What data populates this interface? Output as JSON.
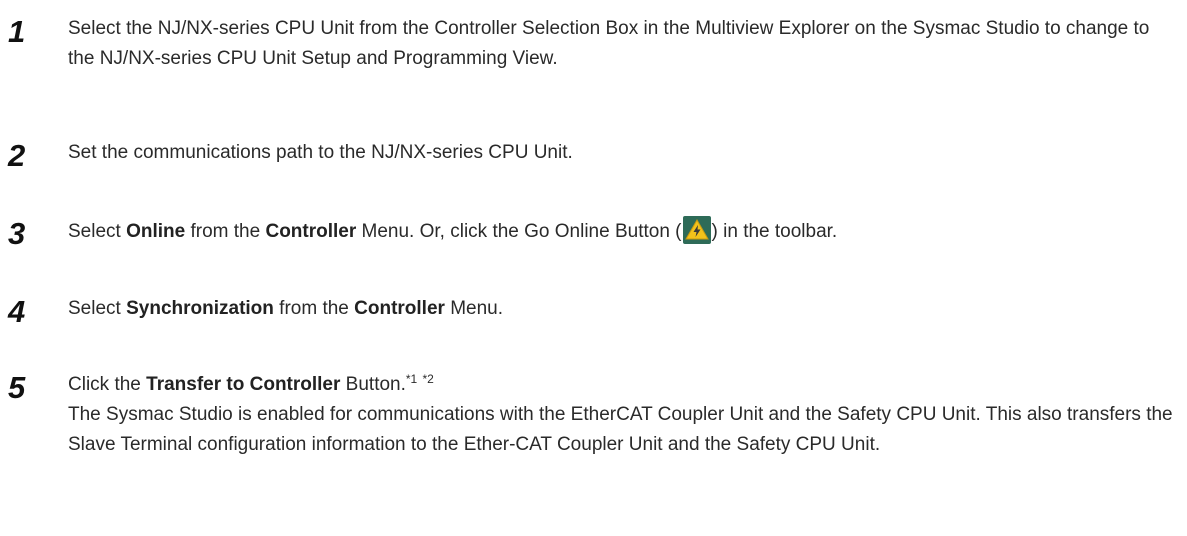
{
  "steps": [
    {
      "number": "1",
      "text": "Select the NJ/NX-series CPU Unit from the Controller Selection Box in the Multiview Explorer on the Sysmac Studio to change to the NJ/NX-series CPU Unit Setup and Programming View."
    },
    {
      "number": "2",
      "text": "Set the communications path to the NJ/NX-series CPU Unit."
    },
    {
      "number": "3",
      "t1": "Select ",
      "b1": "Online",
      "t2": " from the ",
      "b2": "Controller",
      "t3": " Menu. Or, click the Go Online Button (",
      "t4": ") in the toolbar.",
      "icon": "go-online-icon",
      "icon_colors": {
        "background": "#2e6b58",
        "triangle": "#f3c21b",
        "bolt": "#3a3a3a"
      }
    },
    {
      "number": "4",
      "t1": "Select ",
      "b1": "Synchronization",
      "t2": " from the ",
      "b2": "Controller",
      "t3": " Menu."
    },
    {
      "number": "5",
      "t1": "Click the ",
      "b1": "Transfer to Controller",
      "t2": " Button.",
      "sup1": "*1",
      "sup2": "*2",
      "paragraph": "The Sysmac Studio is enabled for communications with the EtherCAT Coupler Unit and the Safety CPU Unit. This also transfers the Slave Terminal configuration information to the Ether-CAT Coupler Unit and the Safety CPU Unit."
    }
  ]
}
